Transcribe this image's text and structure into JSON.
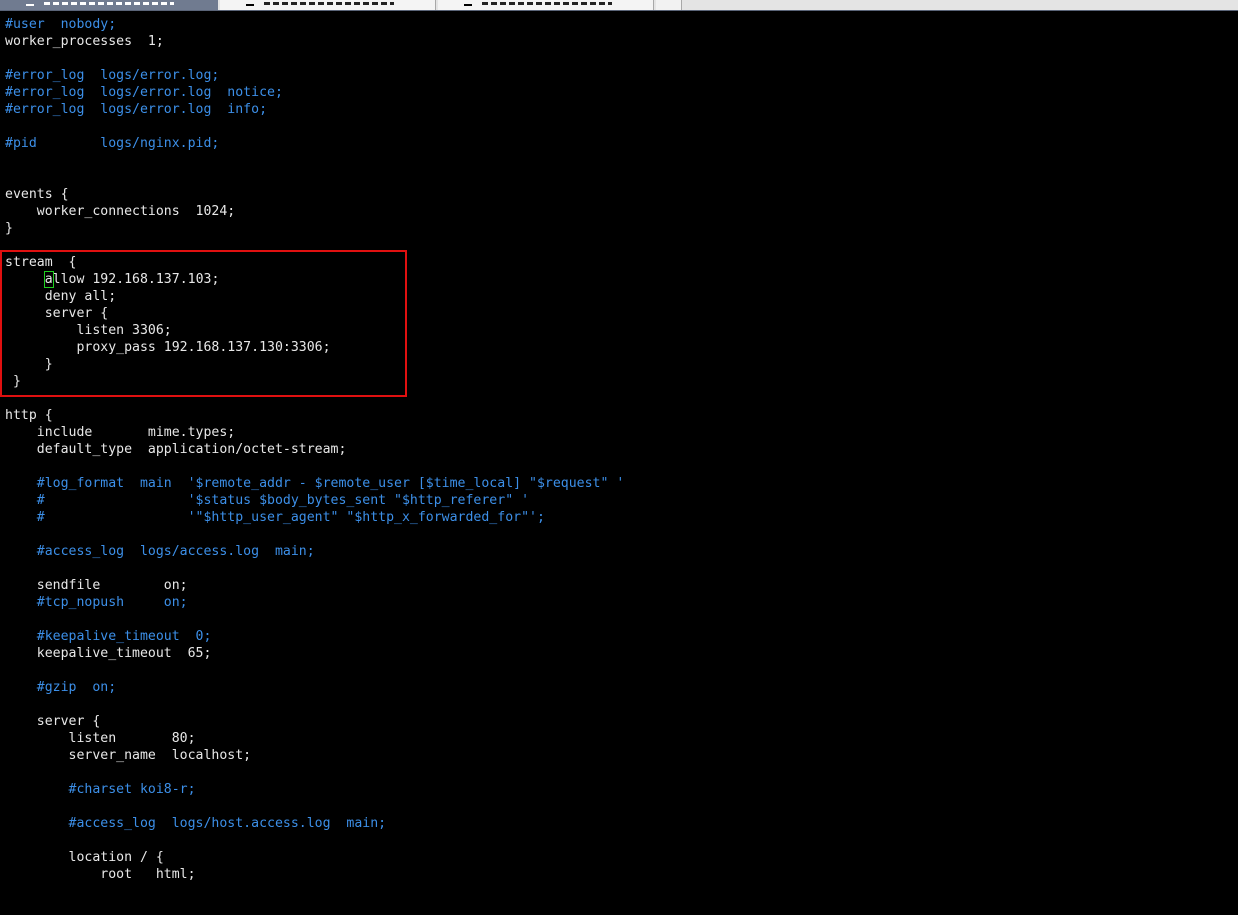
{
  "tabs": [
    {
      "state": "active"
    },
    {
      "state": "inactive"
    },
    {
      "state": "inactive"
    },
    {
      "state": "inactive"
    }
  ],
  "colors": {
    "text": "#e8e8e8",
    "comment": "#3c8fe8",
    "highlight_box": "#e01010",
    "cursor": "#20d020",
    "background": "#000000"
  },
  "editor": {
    "cursor_line": 15,
    "cursor_col": 5,
    "highlight_range": [
      14,
      21
    ],
    "lines": [
      {
        "text": "#user  nobody;",
        "type": "comment"
      },
      {
        "text": "worker_processes  1;",
        "type": "code"
      },
      {
        "text": "",
        "type": "code"
      },
      {
        "text": "#error_log  logs/error.log;",
        "type": "comment"
      },
      {
        "text": "#error_log  logs/error.log  notice;",
        "type": "comment"
      },
      {
        "text": "#error_log  logs/error.log  info;",
        "type": "comment"
      },
      {
        "text": "",
        "type": "code"
      },
      {
        "text": "#pid        logs/nginx.pid;",
        "type": "comment"
      },
      {
        "text": "",
        "type": "code"
      },
      {
        "text": "",
        "type": "code"
      },
      {
        "text": "events {",
        "type": "code"
      },
      {
        "text": "    worker_connections  1024;",
        "type": "code"
      },
      {
        "text": "}",
        "type": "code"
      },
      {
        "text": "",
        "type": "code"
      },
      {
        "text": "stream  {",
        "type": "code"
      },
      {
        "text": "     allow 192.168.137.103;",
        "type": "code"
      },
      {
        "text": "     deny all;",
        "type": "code"
      },
      {
        "text": "     server {",
        "type": "code"
      },
      {
        "text": "         listen 3306;",
        "type": "code"
      },
      {
        "text": "         proxy_pass 192.168.137.130:3306;",
        "type": "code"
      },
      {
        "text": "     }",
        "type": "code"
      },
      {
        "text": " }",
        "type": "code"
      },
      {
        "text": "",
        "type": "code"
      },
      {
        "text": "http {",
        "type": "code"
      },
      {
        "text": "    include       mime.types;",
        "type": "code"
      },
      {
        "text": "    default_type  application/octet-stream;",
        "type": "code"
      },
      {
        "text": "",
        "type": "code"
      },
      {
        "text": "    #log_format  main  '$remote_addr - $remote_user [$time_local] \"$request\" '",
        "type": "comment"
      },
      {
        "text": "    #                  '$status $body_bytes_sent \"$http_referer\" '",
        "type": "comment"
      },
      {
        "text": "    #                  '\"$http_user_agent\" \"$http_x_forwarded_for\"';",
        "type": "comment"
      },
      {
        "text": "",
        "type": "code"
      },
      {
        "text": "    #access_log  logs/access.log  main;",
        "type": "comment"
      },
      {
        "text": "",
        "type": "code"
      },
      {
        "text": "    sendfile        on;",
        "type": "code"
      },
      {
        "text": "    #tcp_nopush     on;",
        "type": "comment"
      },
      {
        "text": "",
        "type": "code"
      },
      {
        "text": "    #keepalive_timeout  0;",
        "type": "comment"
      },
      {
        "text": "    keepalive_timeout  65;",
        "type": "code"
      },
      {
        "text": "",
        "type": "code"
      },
      {
        "text": "    #gzip  on;",
        "type": "comment"
      },
      {
        "text": "",
        "type": "code"
      },
      {
        "text": "    server {",
        "type": "code"
      },
      {
        "text": "        listen       80;",
        "type": "code"
      },
      {
        "text": "        server_name  localhost;",
        "type": "code"
      },
      {
        "text": "",
        "type": "code"
      },
      {
        "text": "        #charset koi8-r;",
        "type": "comment"
      },
      {
        "text": "",
        "type": "code"
      },
      {
        "text": "        #access_log  logs/host.access.log  main;",
        "type": "comment"
      },
      {
        "text": "",
        "type": "code"
      },
      {
        "text": "        location / {",
        "type": "code"
      },
      {
        "text": "            root   html;",
        "type": "code"
      }
    ]
  }
}
